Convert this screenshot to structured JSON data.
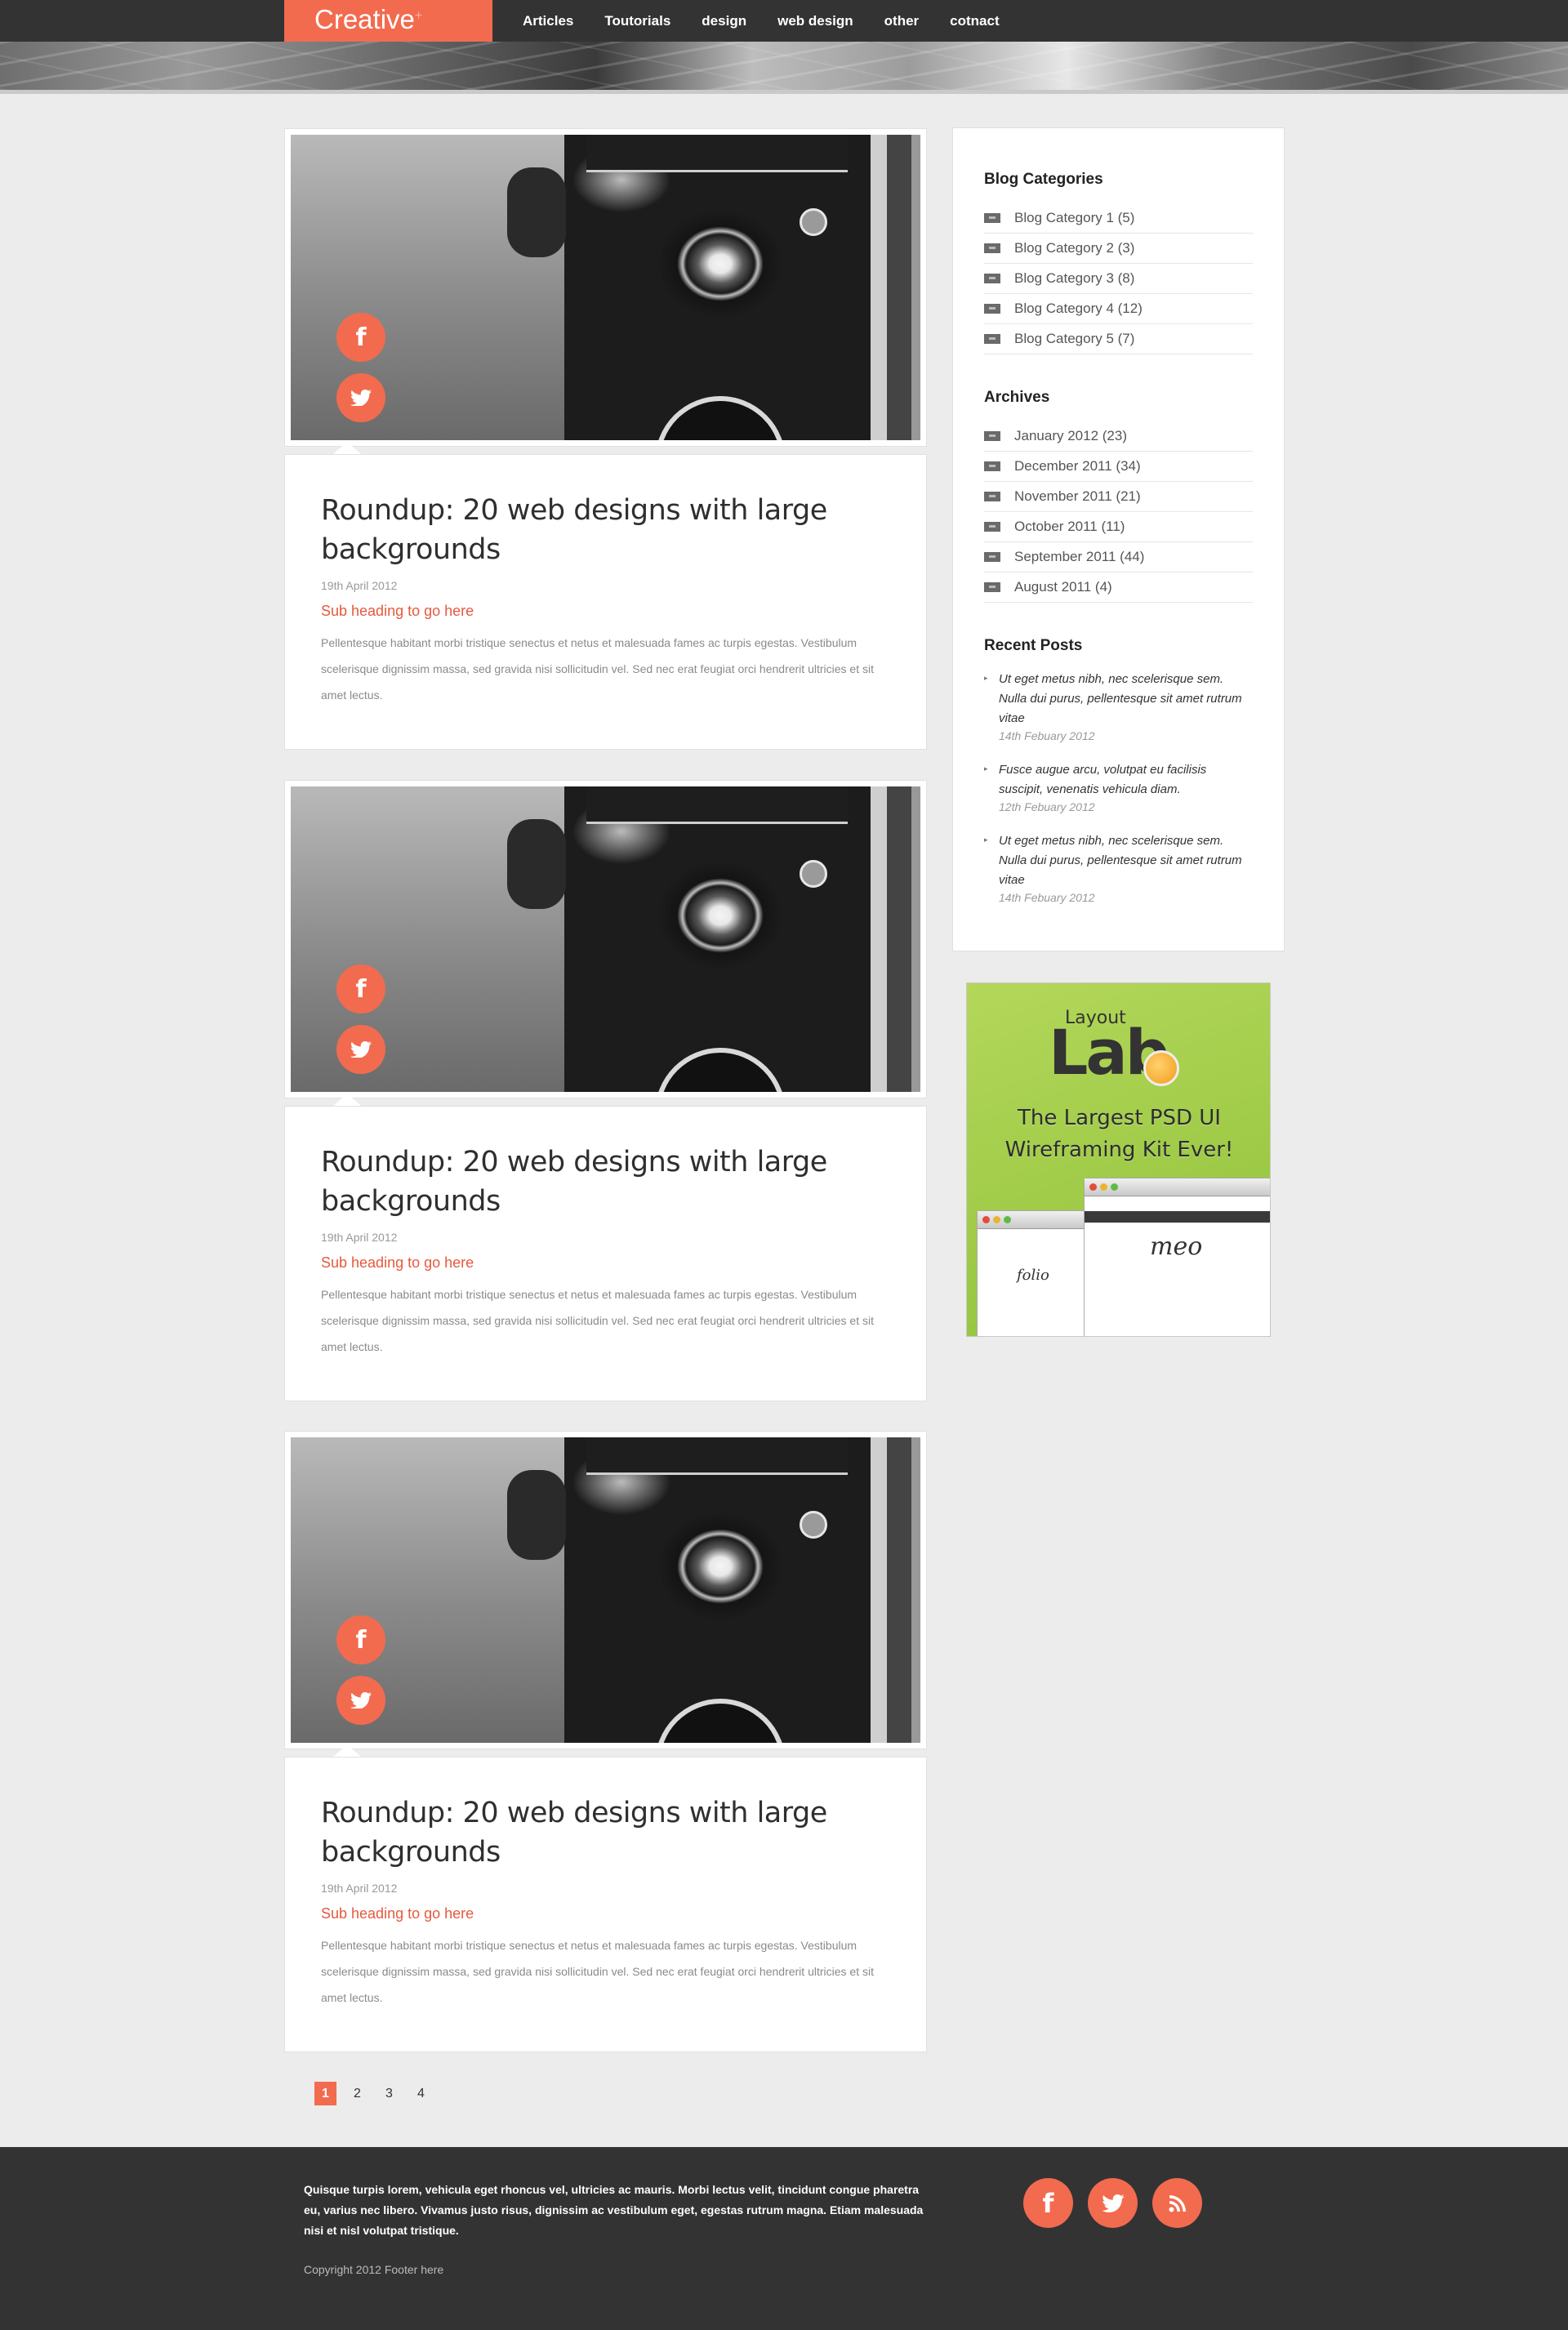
{
  "header": {
    "logo": "Creative",
    "logo_mark": "+",
    "nav": [
      "Articles",
      "Toutorials",
      "design",
      "web design",
      "other",
      "cotnact"
    ]
  },
  "posts": [
    {
      "title": "Roundup: 20 web designs with large backgrounds",
      "date": "19th April 2012",
      "subheading": "Sub heading to go here",
      "body": "Pellentesque habitant morbi tristique senectus et netus et malesuada fames ac turpis egestas. Vestibulum scelerisque dignissim massa, sed gravida nisi sollicitudin vel. Sed nec erat feugiat orci hendrerit ultricies et sit amet lectus."
    },
    {
      "title": "Roundup: 20 web designs with large backgrounds",
      "date": "19th April 2012",
      "subheading": "Sub heading to go here",
      "body": "Pellentesque habitant morbi tristique senectus et netus et malesuada fames ac turpis egestas. Vestibulum scelerisque dignissim massa, sed gravida nisi sollicitudin vel. Sed nec erat feugiat orci hendrerit ultricies et sit amet lectus."
    },
    {
      "title": "Roundup: 20 web designs with large backgrounds",
      "date": "19th April 2012",
      "subheading": "Sub heading to go here",
      "body": "Pellentesque habitant morbi tristique senectus et netus et malesuada fames ac turpis egestas. Vestibulum scelerisque dignissim massa, sed gravida nisi sollicitudin vel. Sed nec erat feugiat orci hendrerit ultricies et sit amet lectus."
    }
  ],
  "pagination": {
    "pages": [
      "1",
      "2",
      "3",
      "4"
    ],
    "active": "1"
  },
  "sidebar": {
    "categories_title": "Blog Categories",
    "categories": [
      "Blog Category 1 (5)",
      "Blog Category 2 (3)",
      "Blog Category 3 (8)",
      "Blog Category 4 (12)",
      "Blog Category 5 (7)"
    ],
    "archives_title": "Archives",
    "archives": [
      "January 2012 (23)",
      "December 2011 (34)",
      "November 2011 (21)",
      "October 2011 (11)",
      "September 2011 (44)",
      "August 2011 (4)"
    ],
    "recent_title": "Recent Posts",
    "recent": [
      {
        "text": "Ut eget metus nibh, nec scelerisque sem. Nulla dui purus, pellentesque sit amet rutrum vitae",
        "date": "14th Febuary 2012"
      },
      {
        "text": "Fusce augue arcu, volutpat eu facilisis suscipit, venenatis vehicula diam.",
        "date": "12th Febuary 2012"
      },
      {
        "text": "Ut eget metus nibh, nec scelerisque sem. Nulla dui purus, pellentesque sit amet rutrum vitae",
        "date": "14th Febuary 2012"
      }
    ]
  },
  "ad": {
    "logo_small": "Layout",
    "logo_big": "Lab",
    "tagline_1": "The Largest PSD UI",
    "tagline_2": "Wireframing Kit Ever!",
    "window_text_1": "folio",
    "window_text_2": "meo"
  },
  "footer": {
    "text": "Quisque turpis lorem, vehicula eget rhoncus vel, ultricies ac mauris. Morbi lectus velit, tincidunt congue pharetra eu, varius nec libero. Vivamus justo risus, dignissim ac vestibulum eget, egestas rutrum magna. Etiam malesuada nisi et nisl volutpat tristique.",
    "copyright": "Copyright 2012 Footer here",
    "social_icons": [
      "facebook-icon",
      "twitter-icon",
      "rss-icon"
    ]
  },
  "colors": {
    "accent": "#f26b4f",
    "dark": "#333333",
    "background": "#ececec"
  }
}
